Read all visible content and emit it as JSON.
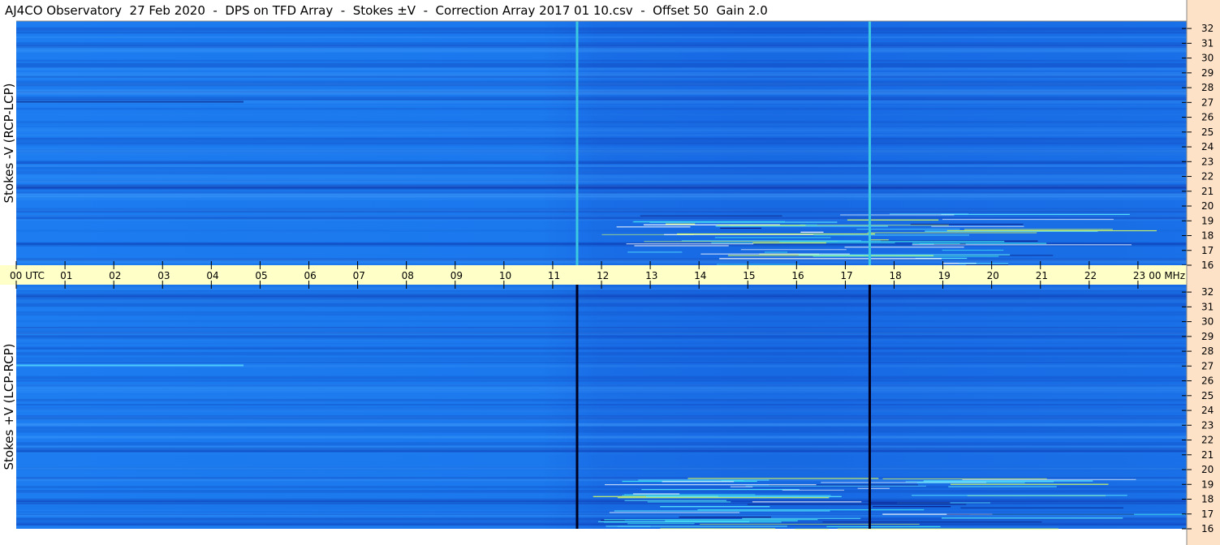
{
  "title": "AJ4CO Observatory  27 Feb 2020  -  DPS on TFD Array  -  Stokes ±V  -  Correction Array 2017 01 10.csv  -  Offset 50  Gain 2.0",
  "colors": {
    "background_blue": "#1c7cf0",
    "dark_blue": "#1048c8",
    "cyan": "#40d8e8",
    "time_axis_band": "#ffffc8",
    "freq_axis_strip": "#fde2c8"
  },
  "chart_data": [
    {
      "type": "heatmap",
      "name": "top-panel",
      "ylabel": "Stokes -V  (RCP-LCP)",
      "freq_ticks": [
        "32",
        "31",
        "30",
        "29",
        "28",
        "27",
        "26",
        "25",
        "24",
        "23",
        "22",
        "21",
        "20",
        "19",
        "18",
        "17",
        "16"
      ],
      "freq_range_mhz": [
        16,
        32.5
      ],
      "time_range_utc": [
        0,
        24
      ],
      "vertical_lines_utc": [
        {
          "time": 11.5,
          "color": "#3cc8e0"
        },
        {
          "time": 17.5,
          "color": "#3cc8e0"
        }
      ]
    },
    {
      "type": "heatmap",
      "name": "bottom-panel",
      "ylabel": "Stokes +V  (LCP-RCP)",
      "freq_ticks": [
        "32",
        "31",
        "30",
        "29",
        "28",
        "27",
        "26",
        "25",
        "24",
        "23",
        "22",
        "21",
        "20",
        "19",
        "18",
        "17",
        "16"
      ],
      "freq_range_mhz": [
        16,
        32.5
      ],
      "time_range_utc": [
        0,
        24
      ],
      "vertical_lines_utc": [
        {
          "time": 11.5,
          "color": "#000020"
        },
        {
          "time": 17.5,
          "color": "#000020"
        }
      ]
    }
  ],
  "time_axis": {
    "labels": [
      "00  UTC",
      "01",
      "02",
      "03",
      "04",
      "05",
      "06",
      "07",
      "08",
      "09",
      "10",
      "11",
      "12",
      "13",
      "14",
      "15",
      "16",
      "17",
      "18",
      "19",
      "20",
      "21",
      "22",
      "23",
      "00 MHz"
    ]
  }
}
